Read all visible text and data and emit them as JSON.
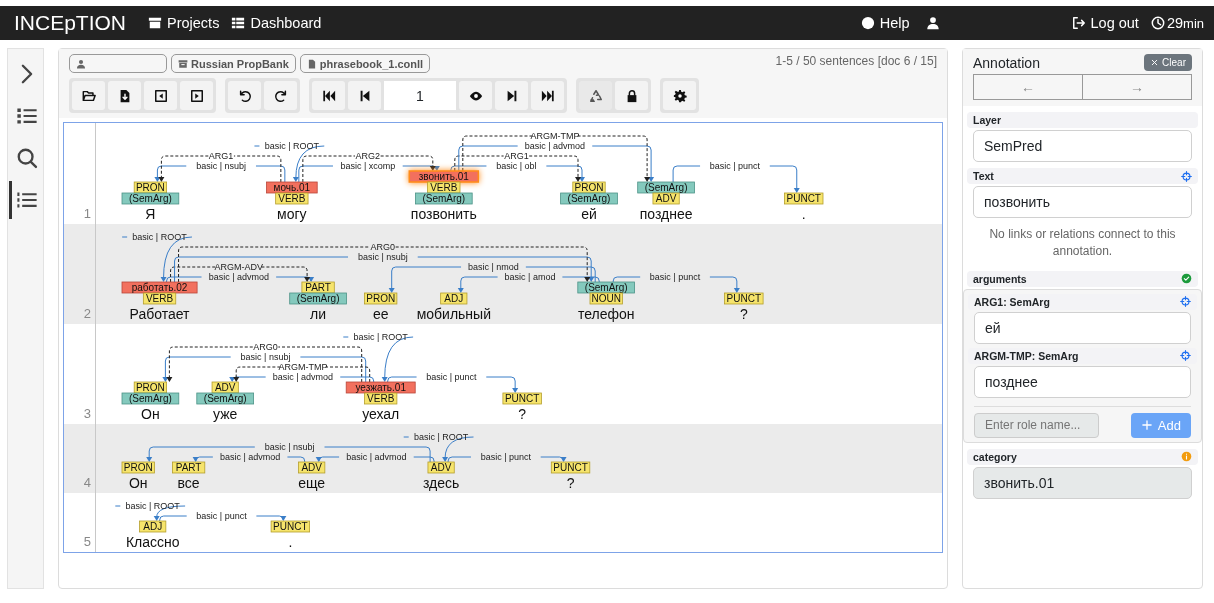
{
  "navbar": {
    "brand": "INCEpTION",
    "links": [
      {
        "kind": "projects",
        "label": "Projects"
      },
      {
        "kind": "dashboard",
        "label": "Dashboard"
      }
    ],
    "help": "Help",
    "logout": "Log out",
    "session": {
      "value": "29",
      "unit": "min"
    }
  },
  "sidebar": {
    "items": [
      {
        "kind": "expand",
        "selected": false
      },
      {
        "kind": "outline",
        "selected": false
      },
      {
        "kind": "search",
        "selected": false
      },
      {
        "kind": "annotations",
        "selected": true
      }
    ]
  },
  "document": {
    "breadcrumbs": [
      {
        "kind": "user"
      },
      {
        "kind": "project",
        "label": "Russian PropBank"
      },
      {
        "kind": "file",
        "label": "phrasebook_1.conll"
      }
    ],
    "position": "1-5 / 50 sentences [doc 6 / 15]",
    "toolbar": [
      [
        {
          "kind": "open"
        },
        {
          "kind": "export"
        },
        {
          "kind": "prevdoc"
        },
        {
          "kind": "nextdoc"
        }
      ],
      [
        {
          "kind": "undo"
        },
        {
          "kind": "redo"
        }
      ],
      [
        {
          "kind": "first"
        },
        {
          "kind": "prev"
        },
        {
          "kind": "page",
          "value": "1"
        },
        {
          "kind": "eye"
        },
        {
          "kind": "next"
        },
        {
          "kind": "last"
        }
      ],
      [
        {
          "kind": "recycle"
        },
        {
          "kind": "lock"
        }
      ],
      [
        {
          "kind": "settings"
        }
      ]
    ]
  },
  "annotation_area": {
    "sentences": [
      {
        "number": "1",
        "root": {
          "text": "могу",
          "relation": "basic | ROOT",
          "labels": [
            {
              "kind": "predicate",
              "text": "мочь.01",
              "selected": false
            },
            {
              "kind": "pos",
              "text": "VERB",
              "selected": false
            }
          ],
          "children": [
            {
              "left_of_head": true,
              "text": "Я",
              "role": "ARG1",
              "relation": "basic | nsubj",
              "labels": [
                {
                  "kind": "pos",
                  "text": "PRON",
                  "selected": false
                },
                {
                  "kind": "argument",
                  "text": "(SemArg)",
                  "selected": false
                }
              ]
            },
            {
              "left_of_head": false,
              "text": "позвонить",
              "role": "ARG2",
              "relation": "basic | xcomp",
              "labels": [
                {
                  "kind": "predicate",
                  "text": "звонить.01",
                  "selected": true
                },
                {
                  "kind": "pos",
                  "text": "VERB",
                  "selected": false
                },
                {
                  "kind": "argument",
                  "text": "(SemArg)",
                  "selected": false
                }
              ],
              "children": [
                {
                  "left_of_head": false,
                  "text": "ей",
                  "role": "ARG1",
                  "relation": "basic | obl",
                  "labels": [
                    {
                      "kind": "pos",
                      "text": "PRON",
                      "selected": false
                    },
                    {
                      "kind": "argument",
                      "text": "(SemArg)",
                      "selected": false
                    }
                  ]
                },
                {
                  "left_of_head": false,
                  "text": "позднее",
                  "role": "ARGM-TMP",
                  "relation": "basic | advmod",
                  "labels": [
                    {
                      "kind": "argument",
                      "text": "(SemArg)",
                      "selected": false
                    },
                    {
                      "kind": "pos",
                      "text": "ADV",
                      "selected": false
                    }
                  ],
                  "children": [
                    {
                      "left_of_head": false,
                      "text": ".",
                      "relation": "basic | punct",
                      "labels": [
                        {
                          "kind": "pos",
                          "text": "PUNCT",
                          "selected": false
                        }
                      ]
                    }
                  ]
                }
              ]
            }
          ]
        }
      },
      {
        "number": "2",
        "root": {
          "text": "Работает",
          "relation": "basic | ROOT",
          "labels": [
            {
              "kind": "predicate",
              "text": "работать.02",
              "selected": false
            },
            {
              "kind": "pos",
              "text": "VERB",
              "selected": false
            }
          ],
          "children": [
            {
              "left_of_head": false,
              "text": "ли",
              "role": "ARGM-ADV",
              "relation": "basic | advmod",
              "labels": [
                {
                  "kind": "pos",
                  "text": "PART",
                  "selected": false
                },
                {
                  "kind": "argument",
                  "text": "(SemArg)",
                  "selected": false
                }
              ]
            },
            {
              "left_of_head": false,
              "text": "телефон",
              "role": "ARG0",
              "relation": "basic | nsubj",
              "labels": [
                {
                  "kind": "argument",
                  "text": "(SemArg)",
                  "selected": false
                },
                {
                  "kind": "pos",
                  "text": "NOUN",
                  "selected": false
                }
              ],
              "children": [
                {
                  "left_of_head": true,
                  "text": "ее",
                  "relation": "basic | nmod",
                  "labels": [
                    {
                      "kind": "pos",
                      "text": "PRON",
                      "selected": false
                    }
                  ]
                },
                {
                  "left_of_head": true,
                  "text": "мобильный",
                  "relation": "basic | amod",
                  "labels": [
                    {
                      "kind": "pos",
                      "text": "ADJ",
                      "selected": false
                    }
                  ]
                },
                {
                  "left_of_head": false,
                  "text": "?",
                  "relation": "basic | punct",
                  "labels": [
                    {
                      "kind": "pos",
                      "text": "PUNCT",
                      "selected": false
                    }
                  ]
                }
              ]
            }
          ]
        }
      },
      {
        "number": "3",
        "root": {
          "text": "уехал",
          "relation": "basic | ROOT",
          "labels": [
            {
              "kind": "predicate",
              "text": "уезжать.01",
              "selected": false
            },
            {
              "kind": "pos",
              "text": "VERB",
              "selected": false
            }
          ],
          "children": [
            {
              "left_of_head": true,
              "text": "Он",
              "role": "ARG0",
              "relation": "basic | nsubj",
              "labels": [
                {
                  "kind": "pos",
                  "text": "PRON",
                  "selected": false
                },
                {
                  "kind": "argument",
                  "text": "(SemArg)",
                  "selected": false
                }
              ]
            },
            {
              "left_of_head": true,
              "text": "уже",
              "role": "ARGM-TMP",
              "relation": "basic | advmod",
              "labels": [
                {
                  "kind": "pos",
                  "text": "ADV",
                  "selected": false
                },
                {
                  "kind": "argument",
                  "text": "(SemArg)",
                  "selected": false
                }
              ]
            },
            {
              "left_of_head": false,
              "text": "?",
              "relation": "basic | punct",
              "labels": [
                {
                  "kind": "pos",
                  "text": "PUNCT",
                  "selected": false
                }
              ]
            }
          ]
        }
      },
      {
        "number": "4",
        "root": {
          "text": "здесь",
          "relation": "basic | ROOT",
          "labels": [
            {
              "kind": "pos",
              "text": "ADV",
              "selected": false
            }
          ],
          "children": [
            {
              "left_of_head": true,
              "text": "Он",
              "relation": "basic | nsubj",
              "labels": [
                {
                  "kind": "pos",
                  "text": "PRON",
                  "selected": false
                }
              ]
            },
            {
              "left_of_head": true,
              "text": "еще",
              "relation": "basic | advmod",
              "labels": [
                {
                  "kind": "pos",
                  "text": "ADV",
                  "selected": false
                }
              ],
              "children": [
                {
                  "left_of_head": true,
                  "text": "все",
                  "relation": "basic | advmod",
                  "labels": [
                    {
                      "kind": "pos",
                      "text": "PART",
                      "selected": false
                    }
                  ]
                }
              ]
            },
            {
              "left_of_head": false,
              "text": "?",
              "relation": "basic | punct",
              "labels": [
                {
                  "kind": "pos",
                  "text": "PUNCT",
                  "selected": false
                }
              ]
            }
          ]
        }
      },
      {
        "number": "5",
        "root": {
          "text": "Классно",
          "relation": "basic | ROOT",
          "labels": [
            {
              "kind": "pos",
              "text": "ADJ",
              "selected": false
            }
          ],
          "children": [
            {
              "left_of_head": false,
              "text": ".",
              "relation": "basic | punct",
              "labels": [
                {
                  "kind": "pos",
                  "text": "PUNCT",
                  "selected": false
                }
              ]
            }
          ]
        }
      }
    ]
  },
  "detail_panel": {
    "title": "Annotation",
    "clear": "Clear",
    "nav": [
      "←",
      "→"
    ],
    "layer": {
      "label": "Layer",
      "value": "SemPred"
    },
    "text": {
      "label": "Text",
      "value": "позвонить"
    },
    "note": "No links or relations connect to this annotation.",
    "arguments": {
      "label": "arguments",
      "roles": [
        {
          "label": "ARG1: SemArg",
          "value": "ей"
        },
        {
          "label": "ARGM-TMP: SemArg",
          "value": "позднее"
        }
      ],
      "placeholder": "Enter role name...",
      "add": "Add"
    },
    "category": {
      "label": "category",
      "value": "звонить.01",
      "disabled": true
    }
  }
}
